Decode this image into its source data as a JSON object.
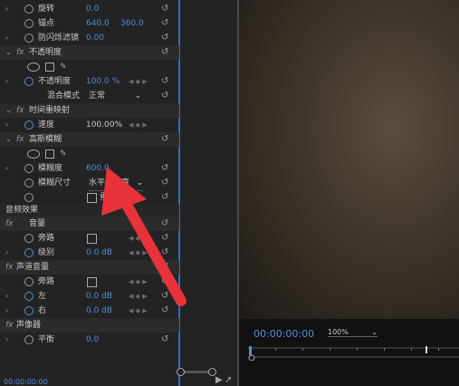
{
  "effects": {
    "rotate": {
      "label": "旋转",
      "value": "0.0"
    },
    "anchor": {
      "label": "锚点",
      "x": "640.0",
      "y": "360.0"
    },
    "flicker": {
      "label": "防闪烁滤镜",
      "value": "0.00"
    },
    "opacity_section": "不透明度",
    "opacity": {
      "label": "不透明度",
      "value": "100.0 %"
    },
    "blend": {
      "label": "混合模式",
      "value": "正常"
    },
    "time_remap_section": "时间重映射",
    "speed": {
      "label": "速度",
      "value": "100.00%"
    },
    "gaussian_section": "高斯模糊",
    "blurriness": {
      "label": "模糊度",
      "value": "600.0"
    },
    "blur_dims": {
      "label": "模糊尺寸",
      "value": "水平和垂直"
    },
    "repeat_edge": {
      "label": "重复"
    },
    "audio_header": "音频效果",
    "volume_section": "音量",
    "vol_bypass": {
      "label": "旁路"
    },
    "vol_level": {
      "label": "级别",
      "value": "0.0 dB"
    },
    "channel_section": "声道音量",
    "ch_bypass": {
      "label": "旁路"
    },
    "ch_left": {
      "label": "左",
      "value": "0.0 dB"
    },
    "ch_right": {
      "label": "右",
      "value": "0.0 dB"
    },
    "panner_section": "声像器",
    "balance": {
      "label": "平衡",
      "value": "0.0"
    }
  },
  "left_timecode": "00:00:00:00",
  "program": {
    "timecode": "00:00:00:00",
    "zoom": "100%"
  },
  "colors": {
    "accent": "#4d8fd6",
    "arrow": "#e8333a"
  }
}
